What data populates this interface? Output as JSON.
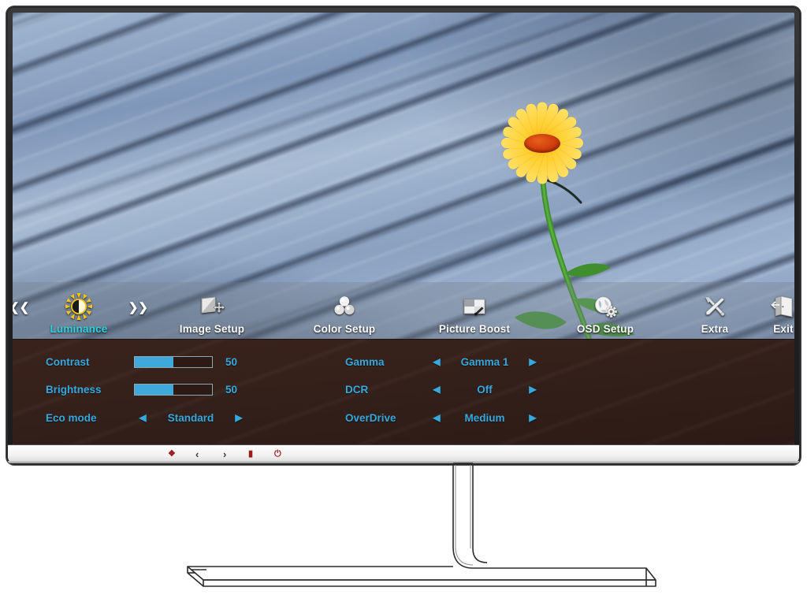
{
  "device": {
    "type": "lcd-monitor",
    "osd_title": "Luminance"
  },
  "osd": {
    "menu": [
      {
        "id": "luminance",
        "label": "Luminance",
        "icon": "sun-icon",
        "selected": true
      },
      {
        "id": "image-setup",
        "label": "Image Setup",
        "icon": "image-move-icon",
        "selected": false
      },
      {
        "id": "color-setup",
        "label": "Color Setup",
        "icon": "color-spheres-icon",
        "selected": false
      },
      {
        "id": "picture-boost",
        "label": "Picture Boost",
        "icon": "picture-boost-icon",
        "selected": false
      },
      {
        "id": "osd-setup",
        "label": "OSD Setup",
        "icon": "globe-gear-icon",
        "selected": false
      },
      {
        "id": "extra",
        "label": "Extra",
        "icon": "tools-cross-icon",
        "selected": false
      },
      {
        "id": "exit",
        "label": "Exit",
        "icon": "exit-door-icon",
        "selected": false
      }
    ],
    "nav": {
      "prev": "❮❮",
      "next": "❯❯"
    },
    "arrows": {
      "left": "◀",
      "right": "▶"
    },
    "settings_left": [
      {
        "id": "contrast",
        "label": "Contrast",
        "control": "slider",
        "value": 50,
        "value_text": "50",
        "percent": 50
      },
      {
        "id": "brightness",
        "label": "Brightness",
        "control": "slider",
        "value": 50,
        "value_text": "50",
        "percent": 50
      },
      {
        "id": "eco-mode",
        "label": "Eco mode",
        "control": "option",
        "value_text": "Standard"
      }
    ],
    "settings_right": [
      {
        "id": "gamma",
        "label": "Gamma",
        "control": "option",
        "value_text": "Gamma 1"
      },
      {
        "id": "dcr",
        "label": "DCR",
        "control": "option",
        "value_text": "Off"
      },
      {
        "id": "overdrive",
        "label": "OverDrive",
        "control": "option",
        "value_text": "Medium"
      }
    ],
    "colors": {
      "accent_text": "#35a8dd",
      "selected_label": "#2fd2e0",
      "slider_fill": "#3fa9dc",
      "panel_bg": "#34201a",
      "menubar_bg": "rgba(120,128,140,.34)"
    }
  },
  "bezel_buttons": [
    {
      "id": "auto-source",
      "icon": "auto-source-icon",
      "glyph": "❖",
      "color": "#9f1b1b"
    },
    {
      "id": "left",
      "icon": "chevron-left-icon",
      "glyph": "‹",
      "color": "#3a3a3a"
    },
    {
      "id": "right",
      "icon": "chevron-right-icon",
      "glyph": "›",
      "color": "#3a3a3a"
    },
    {
      "id": "menu",
      "icon": "menu-icon",
      "glyph": "▮",
      "color": "#9f1b1b"
    },
    {
      "id": "power",
      "icon": "power-icon",
      "glyph": "⏻",
      "color": "#9f1b1b"
    }
  ],
  "wallpaper": {
    "description": "yellow-daisy-on-blue-weathered-wood",
    "flower_petal_color": "#ffcf2e",
    "flower_core_color": "#cf3d0d",
    "stem_color": "#3f8f2e",
    "wood_color": "#8fa6c4"
  }
}
